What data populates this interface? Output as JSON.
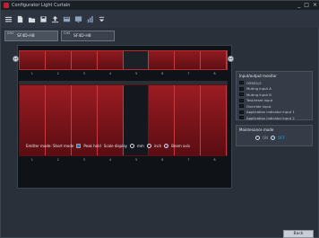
{
  "window": {
    "title": "Configurator Light Curtain",
    "min": "_",
    "max": "□",
    "close": "×"
  },
  "toolbar": {
    "icons": [
      "menu-icon",
      "new-file-icon",
      "open-folder-icon",
      "save-icon",
      "upload-icon",
      "teach-icon",
      "monitor-icon",
      "chart-icon",
      "dropdown-icon"
    ]
  },
  "channels": [
    {
      "label": "CH1",
      "value": "SF4D-H8"
    },
    {
      "label": "CH2",
      "value": "SF4D-H8"
    }
  ],
  "beam_strip_top": {
    "numbers": [
      "1",
      "2",
      "3",
      "4",
      "5",
      "6",
      "7",
      "8"
    ],
    "active": [
      true,
      true,
      true,
      true,
      false,
      true,
      true,
      true
    ]
  },
  "beam_strip_main": {
    "numbers": [
      "1",
      "2",
      "3",
      "4",
      "5",
      "6",
      "7",
      "8"
    ],
    "active": [
      true,
      true,
      true,
      true,
      false,
      true,
      true,
      true
    ]
  },
  "settings": {
    "emitter_label": "Emitter mode: Short mode",
    "peak_hold_label": "Peak hold",
    "peak_hold_checked": true,
    "scale_label": "Scale display",
    "opt_mm": "mm",
    "opt_inch": "inch",
    "opt_beam": "Beam axis",
    "selected": "Beam axis"
  },
  "io_monitor": {
    "title": "Input/output monitor",
    "items": [
      "OSSD1/2",
      "Muting input A",
      "Muting input B",
      "Test/reset input",
      "Override input",
      "Application indicator input 1",
      "Application indicator input 2"
    ]
  },
  "maintenance": {
    "title": "Maintenance mode",
    "on": "ON",
    "off": "OFF",
    "selected": "OFF"
  },
  "footer": {
    "back_label": "Back"
  },
  "colors": {
    "beam_active": "#8e1a20",
    "beam_border": "#c63a42",
    "accent": "#2f9ed6"
  }
}
